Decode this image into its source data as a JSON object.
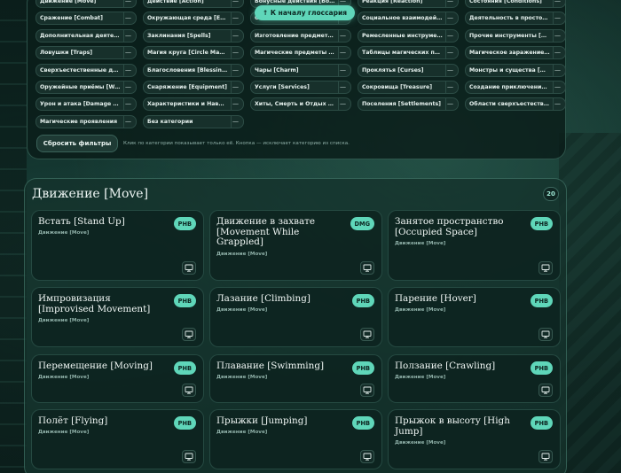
{
  "filters": {
    "chips": [
      "Движение [Move]",
      "Действие [Action]",
      "Бонусные действия [Bonus Actions]",
      "Реакция [Reaction]",
      "Состояния [Conditions]",
      "Сражение [Combat]",
      "Окружающая среда [Environment]",
      "Описание [Features]",
      "Социальное взаимодействие [Social]",
      "Деятельность в простое [Downtime]",
      "Дополнительная деятельность",
      "Заклинания [Spells]",
      "Изготовление предметов 2024",
      "Ремесленные инструменты",
      "Прочие инструменты [Other Tools]",
      "Ловушки [Traps]",
      "Магия круга [Circle Magic]",
      "Магические предметы [Magic Items]",
      "Таблицы магических предметов",
      "Магическое заражение [Magic]",
      "Сверхъестественные дары",
      "Благословения [Blessings]",
      "Чары [Charm]",
      "Проклятья [Curses]",
      "Монстры и существа [Monsters]",
      "Оружейные приёмы [Weapon Mastery]",
      "Снаряжение [Equipment]",
      "Услуги [Services]",
      "Сокровища [Treasure]",
      "Создание приключений [Creation]",
      "Урон и атака [Damage and Attack]",
      "Характеристики и Навыки",
      "Хиты, Смерть и Отдых [Hit Points]",
      "Поселения [Settlements]",
      "Области сверхъестественного",
      "Магические проявления",
      "Без категории"
    ],
    "toggle_symbol": "—",
    "back_to_glossary": "↑ К началу глоссария",
    "reset_label": "Сбросить фильтры",
    "hint": "Клик по категории показывает только её. Кнопка — исключает категорию из списка."
  },
  "section": {
    "title": "Движение [Move]",
    "count": "20",
    "cards": [
      {
        "title": "Встать [Stand Up]",
        "sub": "Движение [Move]",
        "badge": "PHB"
      },
      {
        "title": "Движение в захвате [Movement While Grappled]",
        "sub": "Движение [Move]",
        "badge": "DMG"
      },
      {
        "title": "Занятое пространство [Occupied Space]",
        "sub": "Движение [Move]",
        "badge": "PHB"
      },
      {
        "title": "Импровизация [Improvised Movement]",
        "sub": "Движение [Move]",
        "badge": "PHB"
      },
      {
        "title": "Лазание [Climbing]",
        "sub": "Движение [Move]",
        "badge": "PHB"
      },
      {
        "title": "Парение [Hover]",
        "sub": "Движение [Move]",
        "badge": "PHB"
      },
      {
        "title": "Перемещение [Moving]",
        "sub": "Движение [Move]",
        "badge": "PHB"
      },
      {
        "title": "Плавание [Swimming]",
        "sub": "Движение [Move]",
        "badge": "PHB"
      },
      {
        "title": "Ползание [Crawling]",
        "sub": "Движение [Move]",
        "badge": "PHB"
      },
      {
        "title": "Полёт [Flying]",
        "sub": "Движение [Move]",
        "badge": "PHB"
      },
      {
        "title": "Прыжки [Jumping]",
        "sub": "Движение [Move]",
        "badge": "PHB"
      },
      {
        "title": "Прыжок в высоту [High Jump]",
        "sub": "Движение [Move]",
        "badge": "PHB"
      }
    ]
  }
}
